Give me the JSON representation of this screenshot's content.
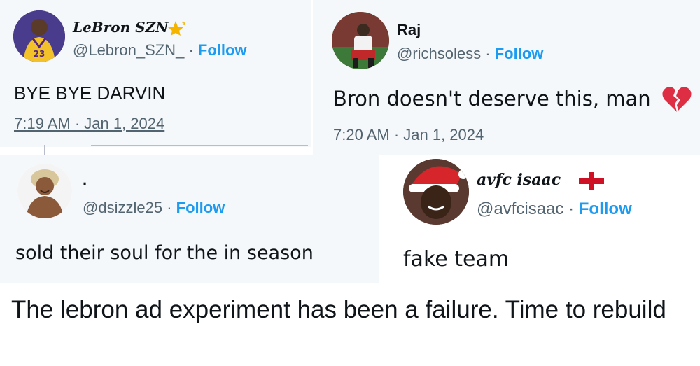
{
  "tweets": [
    {
      "display_name": "LeBron SZN",
      "handle": "@Lebron_SZN_",
      "follow_label": "Follow",
      "separator": "·",
      "text": "BYE BYE DARVIN",
      "timestamp": "7:19 AM · Jan 1, 2024",
      "badge_icon": "sparkle-star-icon",
      "avatar_label": "23"
    },
    {
      "display_name": "Raj",
      "handle": "@richsoless",
      "follow_label": "Follow",
      "separator": "·",
      "text": "Bron doesn't deserve this, man",
      "timestamp": "7:20 AM · Jan 1, 2024",
      "emoji_icon": "broken-heart-icon"
    },
    {
      "display_name": ".",
      "handle": "@dsizzle25",
      "follow_label": "Follow",
      "separator": "·",
      "text": "sold their soul for the in season"
    },
    {
      "display_name": "avfc isaac",
      "handle": "@avfcisaac",
      "follow_label": "Follow",
      "separator": "·",
      "text": "fake team",
      "flag_icon": "england-flag-icon"
    }
  ],
  "caption": "The lebron ad experiment has been a failure. Time to rebuild",
  "colors": {
    "follow": "#1d9bf0",
    "secondary": "#536471",
    "card_bg": "#f5f8fa"
  }
}
